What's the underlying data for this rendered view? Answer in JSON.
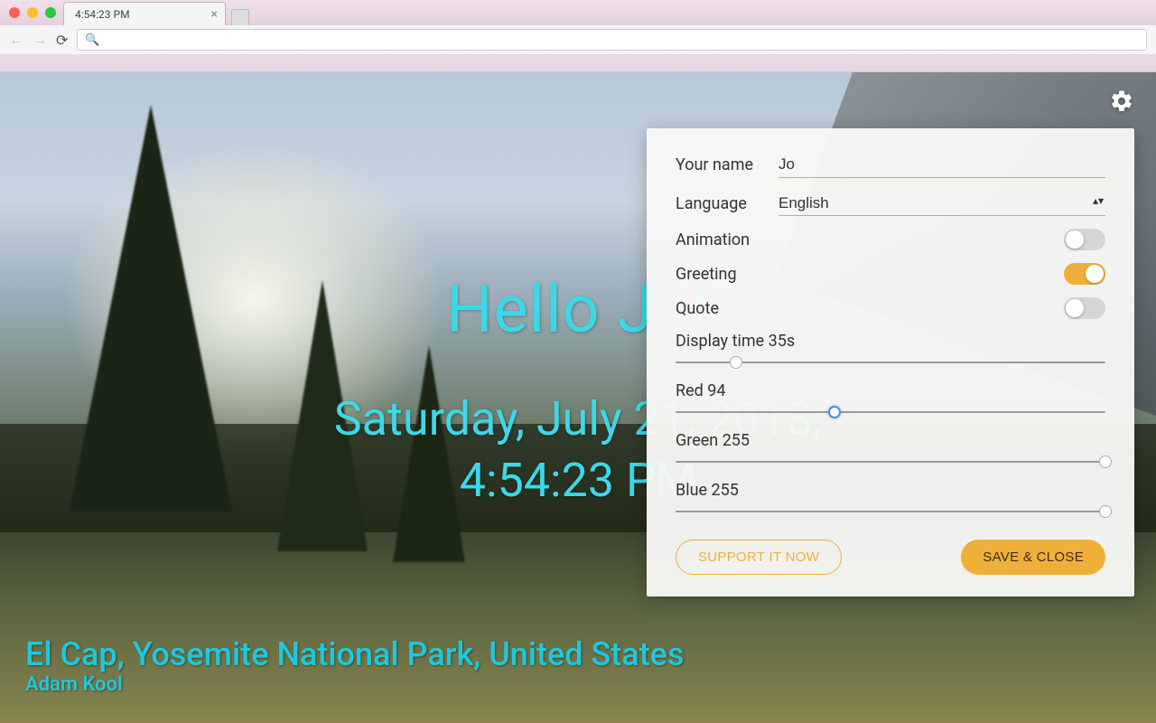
{
  "browser": {
    "tab_title": "4:54:23 PM"
  },
  "page": {
    "greeting": "Hello Jo!",
    "date_line1": "Saturday, July 21, 2018,",
    "date_line2": "4:54:23 PM",
    "location": "El Cap, Yosemite National Park, United States",
    "photographer": "Adam Kool"
  },
  "settings": {
    "name_label": "Your name",
    "name_value": "Jo",
    "language_label": "Language",
    "language_value": "English",
    "animation_label": "Animation",
    "animation_on": false,
    "greeting_label": "Greeting",
    "greeting_on": true,
    "quote_label": "Quote",
    "quote_on": false,
    "display_time_label": "Display time 35s",
    "display_time_pct": 14,
    "red_label": "Red 94",
    "red_pct": 37,
    "green_label": "Green 255",
    "green_pct": 100,
    "blue_label": "Blue 255",
    "blue_pct": 100,
    "support_btn": "SUPPORT IT NOW",
    "save_btn": "SAVE & CLOSE"
  }
}
